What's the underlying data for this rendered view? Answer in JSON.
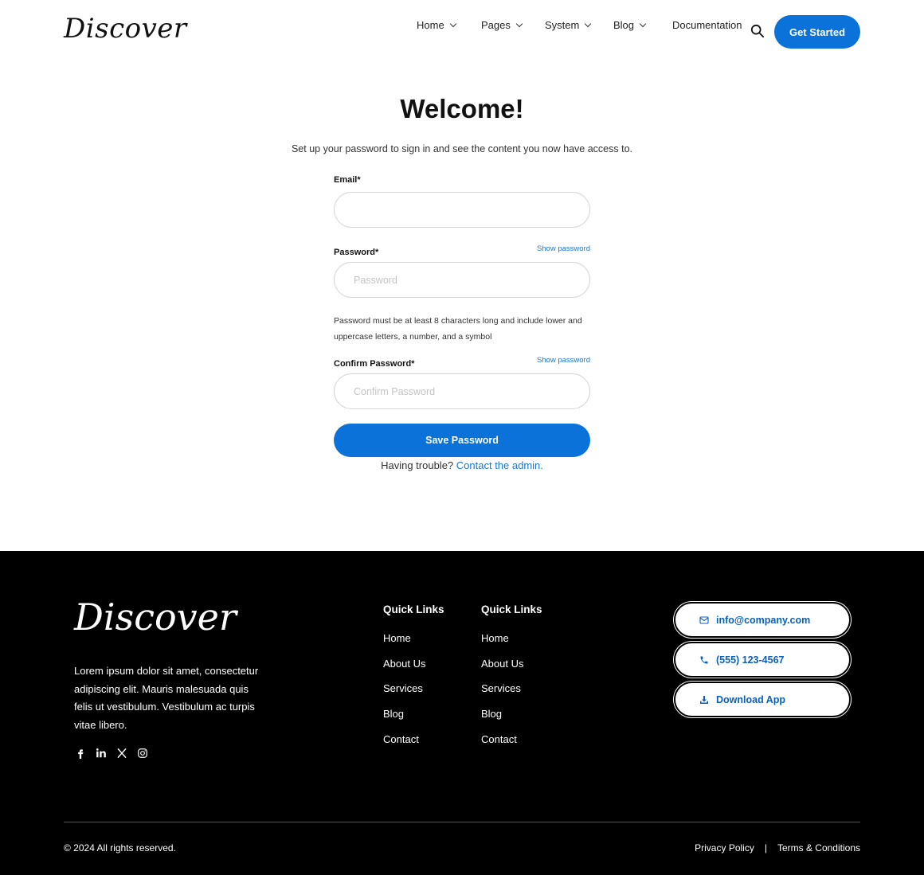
{
  "header": {
    "logo": "Discover",
    "nav": [
      {
        "label": "Home",
        "has_dropdown": true
      },
      {
        "label": "Pages",
        "has_dropdown": true
      },
      {
        "label": "System",
        "has_dropdown": true
      },
      {
        "label": "Blog",
        "has_dropdown": true
      },
      {
        "label": "Documentation",
        "has_dropdown": false
      }
    ],
    "search_icon": "search-icon",
    "cta_label": "Get Started"
  },
  "main": {
    "title": "Welcome!",
    "subtitle": "Set up your password to sign in and see the content you now have access to.",
    "email_label": "Email*",
    "email_value": "",
    "password_label": "Password*",
    "password_placeholder": "Password",
    "show_password": "Show password",
    "hint": "Password must be at least 8 characters long and include lower and uppercase letters, a number, and a symbol",
    "confirm_label": "Confirm Password*",
    "confirm_placeholder": "Confirm Password",
    "save_label": "Save Password",
    "trouble_text": "Having trouble?",
    "contact_link": "Contact the admin."
  },
  "footer": {
    "logo": "Discover",
    "description": "Lorem ipsum dolor sit amet, consectetur adipiscing elit. Mauris malesuada quis felis ut vestibulum. Vestibulum ac turpis vitae libero.",
    "socials": [
      "facebook-icon",
      "linkedin-icon",
      "x-icon",
      "instagram-icon"
    ],
    "columns": [
      {
        "title": "Quick Links",
        "links": [
          "Home",
          "About Us",
          "Services",
          "Blog",
          "Contact"
        ]
      },
      {
        "title": "Quick Links",
        "links": [
          "Home",
          "About Us",
          "Services",
          "Blog",
          "Contact"
        ]
      }
    ],
    "contact": {
      "email": "info@company.com",
      "phone": "(555) 123-4567",
      "app": "Download App"
    },
    "copyright": "© 2024 All rights reserved.",
    "privacy": "Privacy Policy",
    "separator": "|",
    "terms": "Terms & Conditions"
  },
  "colors": {
    "accent": "#0a72d9",
    "link": "#1c77d6",
    "footer_bg": "#000000"
  }
}
